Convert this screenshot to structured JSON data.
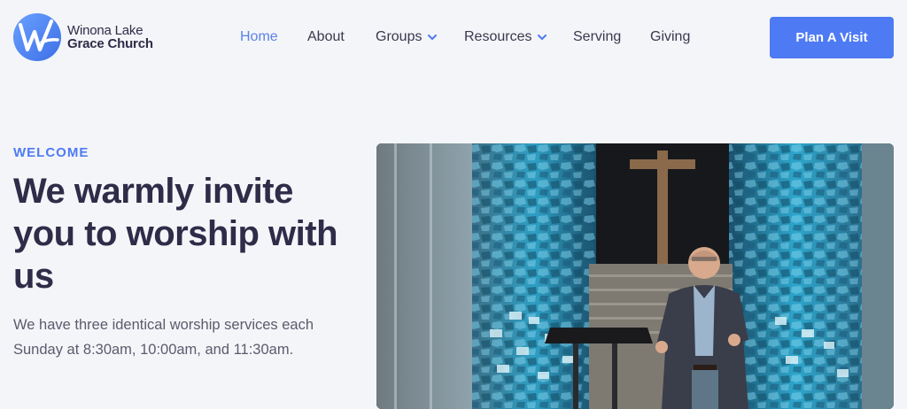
{
  "brand": {
    "line1": "Winona Lake",
    "line2": "Grace Church",
    "accent_color": "#4e7bf4"
  },
  "nav": {
    "items": [
      {
        "label": "Home",
        "active": true,
        "has_dropdown": false
      },
      {
        "label": "About",
        "active": false,
        "has_dropdown": false
      },
      {
        "label": "Groups",
        "active": false,
        "has_dropdown": true
      },
      {
        "label": "Resources",
        "active": false,
        "has_dropdown": true
      },
      {
        "label": "Serving",
        "active": false,
        "has_dropdown": false
      },
      {
        "label": "Giving",
        "active": false,
        "has_dropdown": false
      }
    ],
    "cta_label": "Plan A Visit"
  },
  "hero": {
    "eyebrow": "WELCOME",
    "headline": "We warmly invite you to worship with us",
    "body": "We have three identical worship services each Sunday at 8:30am, 10:00am, and 11:30am.",
    "image_icon": "pastor-preaching-photo"
  }
}
